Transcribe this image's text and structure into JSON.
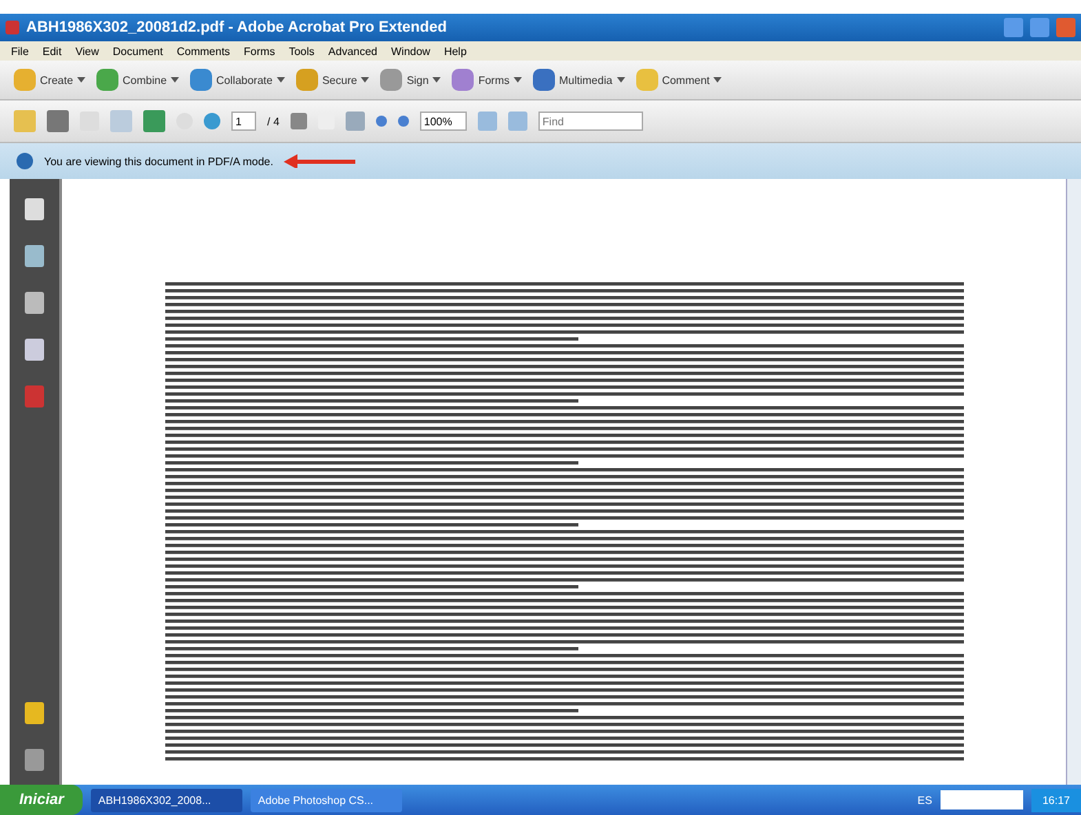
{
  "window": {
    "title": "ABH1986X302_20081d2.pdf - Adobe Acrobat Pro Extended"
  },
  "menu": [
    "File",
    "Edit",
    "View",
    "Document",
    "Comments",
    "Forms",
    "Tools",
    "Advanced",
    "Window",
    "Help"
  ],
  "task_toolbar": [
    {
      "label": "Create"
    },
    {
      "label": "Combine"
    },
    {
      "label": "Collaborate"
    },
    {
      "label": "Secure"
    },
    {
      "label": "Sign"
    },
    {
      "label": "Forms"
    },
    {
      "label": "Multimedia"
    },
    {
      "label": "Comment"
    }
  ],
  "nav_toolbar": {
    "page": "1",
    "page_count": "/ 4",
    "zoom": "100%",
    "find_placeholder": "Find"
  },
  "message_bar": {
    "text": "You are viewing this document in PDF/A mode."
  },
  "taskbar": {
    "start": "Iniciar",
    "tasks": [
      {
        "label": "ABH1986X302_2008...",
        "selected": true
      },
      {
        "label": "Adobe Photoshop CS...",
        "selected": false
      }
    ],
    "language": "ES",
    "clock": "16:17"
  }
}
